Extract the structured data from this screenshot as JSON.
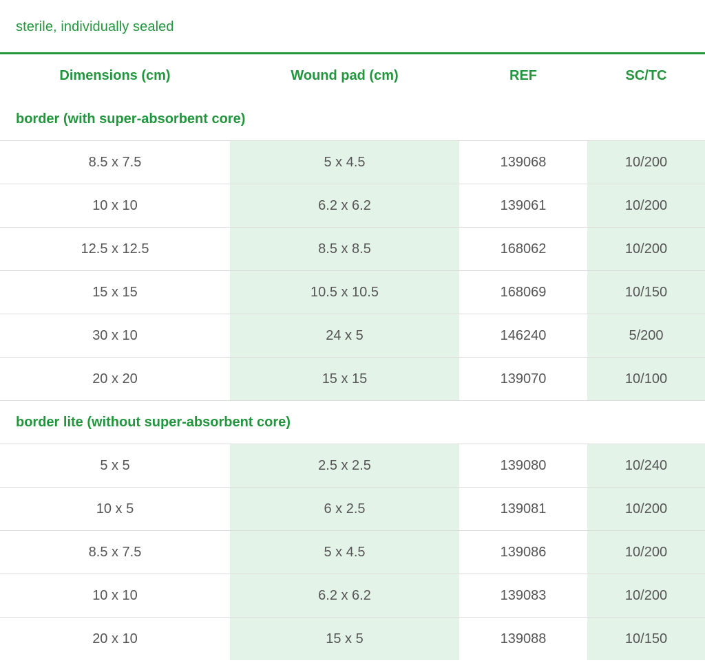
{
  "caption": "sterile, individually sealed",
  "headers": [
    "Dimensions (cm)",
    "Wound pad (cm)",
    "REF",
    "SC/TC"
  ],
  "sections": [
    {
      "title": "border (with super-absorbent core)",
      "rows": [
        [
          "8.5 x 7.5",
          "5 x 4.5",
          "139068",
          "10/200"
        ],
        [
          "10 x 10",
          "6.2 x 6.2",
          "139061",
          "10/200"
        ],
        [
          "12.5 x 12.5",
          "8.5 x 8.5",
          "168062",
          "10/200"
        ],
        [
          "15 x 15",
          "10.5 x 10.5",
          "168069",
          "10/150"
        ],
        [
          "30 x 10",
          "24 x 5",
          "146240",
          "5/200"
        ],
        [
          "20 x 20",
          "15 x 15",
          "139070",
          "10/100"
        ]
      ]
    },
    {
      "title": "border lite (without super-absorbent core)",
      "rows": [
        [
          "5 x 5",
          "2.5 x 2.5",
          "139080",
          "10/240"
        ],
        [
          "10 x 5",
          "6 x 2.5",
          "139081",
          "10/200"
        ],
        [
          "8.5 x 7.5",
          "5 x 4.5",
          "139086",
          "10/200"
        ],
        [
          "10 x 10",
          "6.2 x 6.2",
          "139083",
          "10/200"
        ],
        [
          "20 x 10",
          "15 x 5",
          "139088",
          "10/150"
        ]
      ]
    }
  ],
  "colors": {
    "accent": "#22963c",
    "shade": "#e4f3e8",
    "text": "#555555",
    "divider": "#dcdcdc"
  }
}
